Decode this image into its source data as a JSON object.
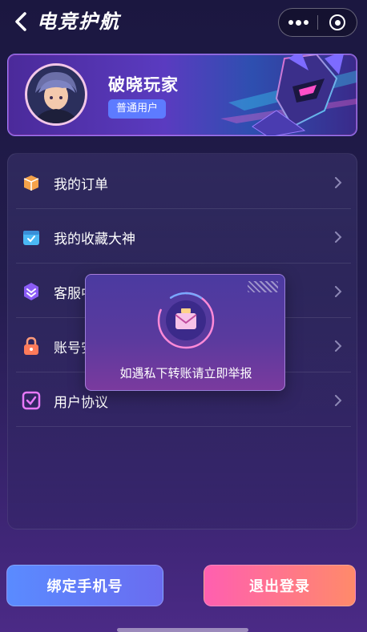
{
  "header": {
    "title": "电竞护航",
    "back_icon": "chevron-left-icon",
    "more_icon": "more-dots-icon",
    "close_icon": "target-circle-icon"
  },
  "profile": {
    "name": "破晓玩家",
    "badge": "普通用户",
    "avatar_icon": "anime-avatar"
  },
  "menu": {
    "items": [
      {
        "label": "我的订单",
        "icon": "box-icon",
        "icon_color": "#f5a24a"
      },
      {
        "label": "我的收藏大神",
        "icon": "calendar-check-icon",
        "icon_color": "#4ab8f5"
      },
      {
        "label": "客服中心",
        "icon": "shield-chevron-icon",
        "icon_color": "#8b5cf6"
      },
      {
        "label": "账号安全",
        "icon": "lock-icon",
        "icon_color": "#ff7a5a"
      },
      {
        "label": "用户协议",
        "icon": "checkbox-icon",
        "icon_color": "#e879f9"
      }
    ],
    "chevron_icon": "chevron-right-icon"
  },
  "toast": {
    "message": "如遇私下转账请立即举报",
    "icon": "envelope-icon"
  },
  "buttons": {
    "bind_phone": "绑定手机号",
    "logout": "退出登录"
  },
  "colors": {
    "badge_bg": "#5d7bff",
    "bind_btn": "#5a8bff",
    "logout_btn": "#ff5fb0"
  }
}
